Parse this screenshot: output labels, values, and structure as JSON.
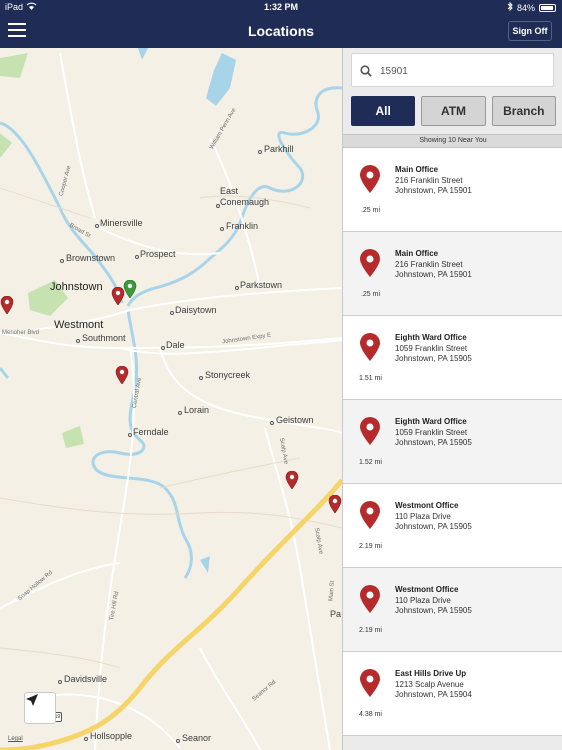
{
  "status_bar": {
    "device": "iPad",
    "time": "1:32 PM",
    "battery": "84%"
  },
  "nav": {
    "title": "Locations",
    "sign_off_label": "Sign Off"
  },
  "search": {
    "value": "15901",
    "placeholder": ""
  },
  "filters": [
    {
      "label": "All",
      "active": true
    },
    {
      "label": "ATM",
      "active": false
    },
    {
      "label": "Branch",
      "active": false
    }
  ],
  "results_caption": "Showing 10 Near You",
  "locations": [
    {
      "name": "Main Office",
      "address": "216 Franklin Street",
      "city": "Johnstown, PA 15901",
      "distance": ".25 mi"
    },
    {
      "name": "Main Office",
      "address": "216 Franklin Street",
      "city": "Johnstown, PA 15901",
      "distance": ".25 mi"
    },
    {
      "name": "Eighth Ward Office",
      "address": "1059 Franklin Street",
      "city": "Johnstown, PA 15905",
      "distance": "1.51 mi"
    },
    {
      "name": "Eighth Ward Office",
      "address": "1059 Franklin Street",
      "city": "Johnstown, PA 15905",
      "distance": "1.52 mi"
    },
    {
      "name": "Westmont Office",
      "address": "110 Plaza Drive",
      "city": "Johnstown, PA 15905",
      "distance": "2.19 mi"
    },
    {
      "name": "Westmont Office",
      "address": "110 Plaza Drive",
      "city": "Johnstown, PA 15905",
      "distance": "2.19 mi"
    },
    {
      "name": "East Hills Drive Up",
      "address": "1213 Scalp Avenue",
      "city": "Johnstown, PA 15904",
      "distance": "4.38 mi"
    }
  ],
  "map": {
    "places": {
      "parkhill": "Parkhill",
      "east_conemaugh": "East\nConemaugh",
      "minersville": "Minersville",
      "franklin": "Franklin",
      "brownstown": "Brownstown",
      "prospect": "Prospect",
      "johnstown": "Johnstown",
      "parkstown": "Parkstown",
      "westmont": "Westmont",
      "southmont": "Southmont",
      "daisytown": "Daisytown",
      "dale": "Dale",
      "stonycreek": "Stonycreek",
      "lorain": "Lorain",
      "geistown": "Geistown",
      "ferndale": "Ferndale",
      "davidsville": "Davidsville",
      "hollsopple": "Hollsopple",
      "seanor": "Seanor",
      "pa": "Pa"
    },
    "roads": {
      "william_penn": "William Penn Ave",
      "cooper": "Cooper Ave",
      "broad": "Broad St",
      "menoher": "Menoher Blvd",
      "johnstown_expy": "Johnstown Expy E",
      "central": "Central Ave",
      "scalp1": "Scalp Ave",
      "scalp2": "Scalp Ave",
      "soap_hollow": "Soap Hollow Rd",
      "tire_hill": "Tire Hill Rd",
      "seanor_rd": "Seanor Rd",
      "main": "Main St"
    },
    "legal": "Legal",
    "route_shield": "219"
  },
  "colors": {
    "navbar": "#1f2c55",
    "pin_red": "#b52b2b",
    "pin_green": "#3c9a3c",
    "water": "#a8d4ea",
    "highway": "#f5d46a"
  }
}
